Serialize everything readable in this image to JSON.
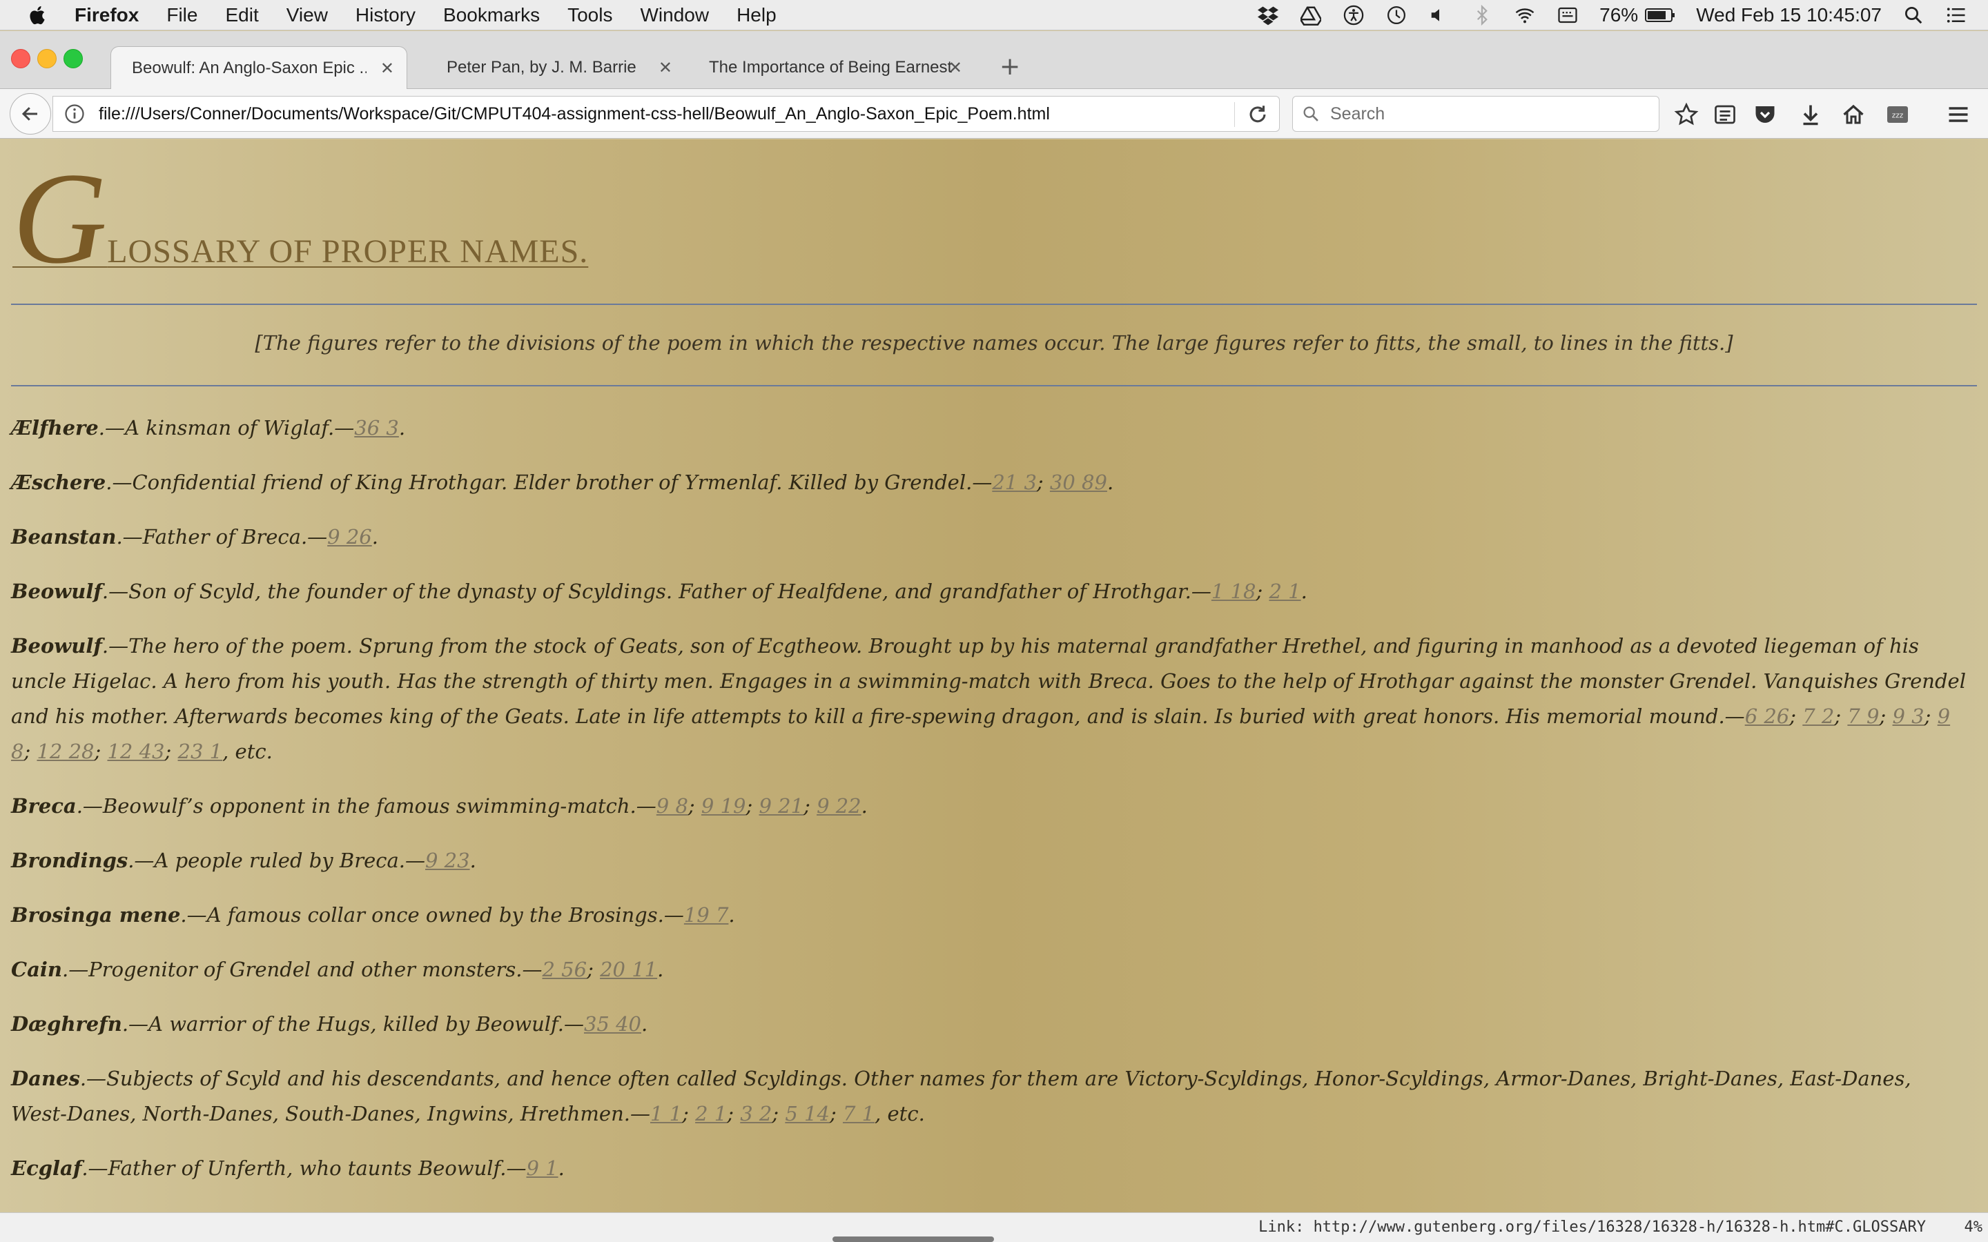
{
  "menubar": {
    "app_name": "Firefox",
    "items": [
      "File",
      "Edit",
      "View",
      "History",
      "Bookmarks",
      "Tools",
      "Window",
      "Help"
    ],
    "status_icons": [
      "dropbox-icon",
      "google-drive-icon",
      "accessibility-icon",
      "time-machine-icon",
      "volume-icon",
      "bluetooth-icon",
      "wifi-icon",
      "keyboard-input-icon"
    ],
    "battery": "76%",
    "clock": "Wed Feb 15  10:45:07"
  },
  "tabs": [
    {
      "label": "Beowulf: An Anglo-Saxon Epic ...",
      "active": true
    },
    {
      "label": "Peter Pan, by J. M. Barrie",
      "active": false
    },
    {
      "label": "The Importance of Being Earnest",
      "active": false
    }
  ],
  "navbar": {
    "url": "file:///Users/Conner/Documents/Workspace/Git/CMPUT404-assignment-css-hell/Beowulf_An_Anglo-Saxon_Epic_Poem.html",
    "search_placeholder": "Search"
  },
  "page": {
    "heading_dropcap": "G",
    "heading_rest": "lossary of proper names.",
    "intro": "[The figures refer to the divisions of the poem in which the respective names occur. The large figures refer to fitts, the small, to lines in the fitts.]",
    "entries": [
      {
        "name": "Ælfhere",
        "text": ".—A kinsman of Wiglaf.—",
        "refs": [
          "36 3"
        ],
        "tail": "."
      },
      {
        "name": "Æschere",
        "text": ".—Confidential friend of King Hrothgar. Elder brother of Yrmenlaf. Killed by Grendel.—",
        "refs": [
          "21 3",
          "30 89"
        ],
        "tail": "."
      },
      {
        "name": "Beanstan",
        "text": ".—Father of Breca.—",
        "refs": [
          "9 26"
        ],
        "tail": "."
      },
      {
        "name": "Beowulf",
        "text": ".—Son of Scyld, the founder of the dynasty of Scyldings. Father of Healfdene, and grandfather of Hrothgar.—",
        "refs": [
          "1 18",
          "2 1"
        ],
        "tail": "."
      },
      {
        "name": "Beowulf",
        "text": ".—The hero of the poem. Sprung from the stock of Geats, son of Ecgtheow. Brought up by his maternal grandfather Hrethel, and figuring in manhood as a devoted liegeman of his uncle Higelac. A hero from his youth. Has the strength of thirty men. Engages in a swimming-match with Breca. Goes to the help of Hrothgar against the monster Grendel. Vanquishes Grendel and his mother. Afterwards becomes king of the Geats. Late in life attempts to kill a fire-spewing dragon, and is slain. Is buried with great honors. His memorial mound.—",
        "refs": [
          "6 26",
          "7 2",
          "7 9",
          "9 3",
          "9 8",
          "12 28",
          "12 43",
          "23 1"
        ],
        "tail": ", etc."
      },
      {
        "name": "Breca",
        "text": ".—Beowulf’s opponent in the famous swimming-match.—",
        "refs": [
          "9 8",
          "9 19",
          "9 21",
          "9 22"
        ],
        "tail": "."
      },
      {
        "name": "Brondings",
        "text": ".—A people ruled by Breca.—",
        "refs": [
          "9 23"
        ],
        "tail": "."
      },
      {
        "name": "Brosinga mene",
        "text": ".—A famous collar once owned by the Brosings.—",
        "refs": [
          "19 7"
        ],
        "tail": "."
      },
      {
        "name": "Cain",
        "text": ".—Progenitor of Grendel and other monsters.—",
        "refs": [
          "2 56",
          "20 11"
        ],
        "tail": "."
      },
      {
        "name": "Dæghrefn",
        "text": ".—A warrior of the Hugs, killed by Beowulf.—",
        "refs": [
          "35 40"
        ],
        "tail": "."
      },
      {
        "name": "Danes",
        "text": ".—Subjects of Scyld and his descendants, and hence often called Scyldings. Other names for them are Victory-Scyldings, Honor-Scyldings, Armor-Danes, Bright-Danes, East-Danes, West-Danes, North-Danes, South-Danes, Ingwins, Hrethmen.—",
        "refs": [
          "1 1",
          "2 1",
          "3 2",
          "5 14",
          "7 1"
        ],
        "tail": ", etc."
      },
      {
        "name": "Ecglaf",
        "text": ".—Father of Unferth, who taunts Beowulf.—",
        "refs": [
          "9 1"
        ],
        "tail": "."
      }
    ]
  },
  "statusbar": {
    "link": "Link: http://www.gutenberg.org/files/16328/16328-h/16328-h.htm#C.GLOSSARY",
    "percent": "4%"
  }
}
